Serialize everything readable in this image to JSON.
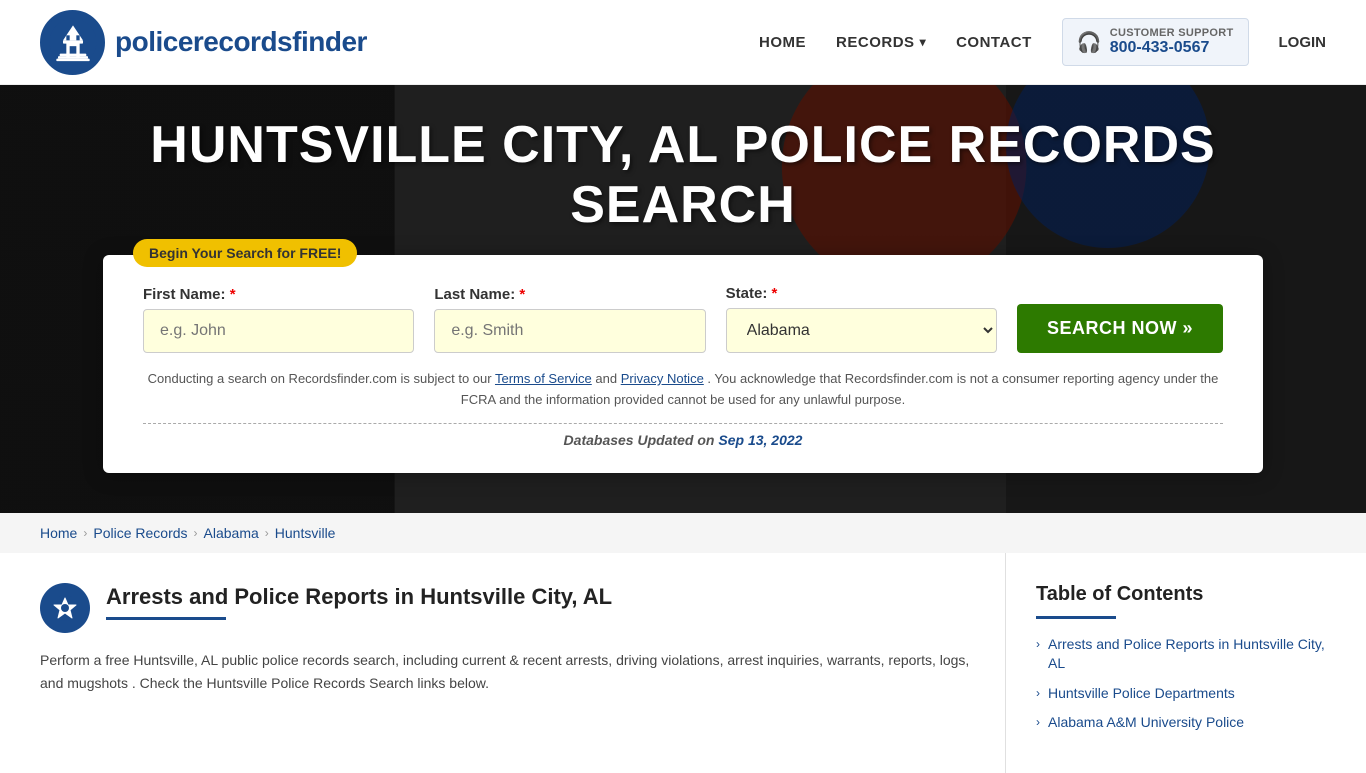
{
  "header": {
    "logo_text_regular": "policerecords",
    "logo_text_bold": "finder",
    "nav": {
      "home": "HOME",
      "records": "RECORDS",
      "contact": "CONTACT",
      "login": "LOGIN"
    },
    "support": {
      "label": "CUSTOMER SUPPORT",
      "number": "800-433-0567"
    }
  },
  "hero": {
    "title": "HUNTSVILLE CITY, AL POLICE RECORDS SEARCH",
    "badge": "Begin Your Search for FREE!"
  },
  "search_form": {
    "first_name_label": "First Name:",
    "first_name_placeholder": "e.g. John",
    "last_name_label": "Last Name:",
    "last_name_placeholder": "e.g. Smith",
    "state_label": "State:",
    "state_value": "Alabama",
    "search_button": "SEARCH NOW »",
    "disclaimer": "Conducting a search on Recordsfinder.com is subject to our Terms of Service and Privacy Notice. You acknowledge that Recordsfinder.com is not a consumer reporting agency under the FCRA and the information provided cannot be used for any unlawful purpose.",
    "db_updated_label": "Databases Updated on",
    "db_updated_date": "Sep 13, 2022"
  },
  "breadcrumb": {
    "items": [
      {
        "label": "Home",
        "href": "#"
      },
      {
        "label": "Police Records",
        "href": "#"
      },
      {
        "label": "Alabama",
        "href": "#"
      },
      {
        "label": "Huntsville",
        "href": "#"
      }
    ]
  },
  "article": {
    "title": "Arrests and Police Reports in Huntsville City, AL",
    "body": "Perform a free Huntsville, AL public police records search, including current & recent arrests, driving violations, arrest inquiries, warrants, reports, logs, and mugshots . Check the Huntsville Police Records Search links below."
  },
  "toc": {
    "title": "Table of Contents",
    "items": [
      {
        "label": "Arrests and Police Reports in Huntsville City, AL"
      },
      {
        "label": "Huntsville Police Departments"
      },
      {
        "label": "Alabama A&M University Police"
      }
    ]
  }
}
